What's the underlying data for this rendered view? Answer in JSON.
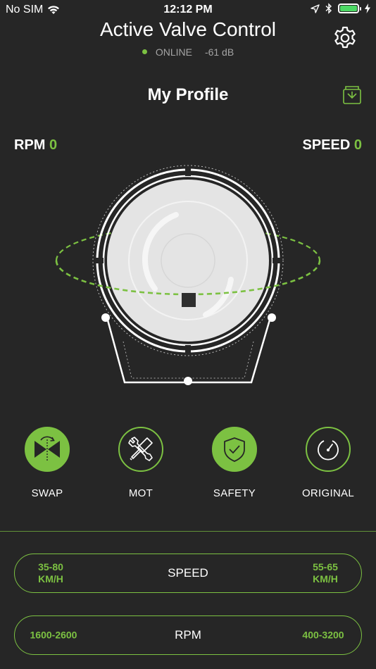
{
  "status_bar": {
    "carrier": "No SIM",
    "time": "12:12 PM"
  },
  "header": {
    "title": "Active Valve Control",
    "connection_status": "ONLINE",
    "signal": "-61 dB"
  },
  "profile": {
    "title": "My Profile"
  },
  "readouts": {
    "rpm_label": "RPM",
    "rpm_value": "0",
    "speed_label": "SPEED",
    "speed_value": "0"
  },
  "modes": [
    {
      "label": "SWAP",
      "active": true,
      "icon": "swap-valve-icon"
    },
    {
      "label": "MOT",
      "active": false,
      "icon": "tools-icon"
    },
    {
      "label": "SAFETY",
      "active": true,
      "icon": "shield-check-icon"
    },
    {
      "label": "ORIGINAL",
      "active": false,
      "icon": "gauge-icon"
    }
  ],
  "ranges": {
    "speed": {
      "label": "SPEED",
      "min": "35-80\nKM/H",
      "max": "55-65\nKM/H"
    },
    "rpm": {
      "label": "RPM",
      "min": "1600-2600",
      "max": "400-3200"
    }
  },
  "colors": {
    "accent": "#7cc142",
    "background": "#262626",
    "battery": "#4cd964"
  }
}
